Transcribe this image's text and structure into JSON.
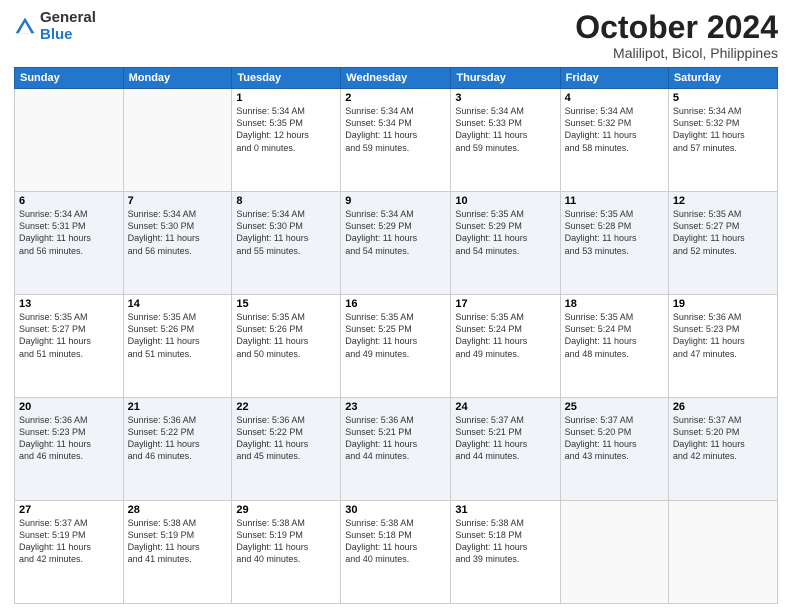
{
  "header": {
    "logo_general": "General",
    "logo_blue": "Blue",
    "month_title": "October 2024",
    "location": "Malilipot, Bicol, Philippines"
  },
  "weekdays": [
    "Sunday",
    "Monday",
    "Tuesday",
    "Wednesday",
    "Thursday",
    "Friday",
    "Saturday"
  ],
  "weeks": [
    [
      {
        "day": "",
        "info": ""
      },
      {
        "day": "",
        "info": ""
      },
      {
        "day": "1",
        "info": "Sunrise: 5:34 AM\nSunset: 5:35 PM\nDaylight: 12 hours\nand 0 minutes."
      },
      {
        "day": "2",
        "info": "Sunrise: 5:34 AM\nSunset: 5:34 PM\nDaylight: 11 hours\nand 59 minutes."
      },
      {
        "day": "3",
        "info": "Sunrise: 5:34 AM\nSunset: 5:33 PM\nDaylight: 11 hours\nand 59 minutes."
      },
      {
        "day": "4",
        "info": "Sunrise: 5:34 AM\nSunset: 5:32 PM\nDaylight: 11 hours\nand 58 minutes."
      },
      {
        "day": "5",
        "info": "Sunrise: 5:34 AM\nSunset: 5:32 PM\nDaylight: 11 hours\nand 57 minutes."
      }
    ],
    [
      {
        "day": "6",
        "info": "Sunrise: 5:34 AM\nSunset: 5:31 PM\nDaylight: 11 hours\nand 56 minutes."
      },
      {
        "day": "7",
        "info": "Sunrise: 5:34 AM\nSunset: 5:30 PM\nDaylight: 11 hours\nand 56 minutes."
      },
      {
        "day": "8",
        "info": "Sunrise: 5:34 AM\nSunset: 5:30 PM\nDaylight: 11 hours\nand 55 minutes."
      },
      {
        "day": "9",
        "info": "Sunrise: 5:34 AM\nSunset: 5:29 PM\nDaylight: 11 hours\nand 54 minutes."
      },
      {
        "day": "10",
        "info": "Sunrise: 5:35 AM\nSunset: 5:29 PM\nDaylight: 11 hours\nand 54 minutes."
      },
      {
        "day": "11",
        "info": "Sunrise: 5:35 AM\nSunset: 5:28 PM\nDaylight: 11 hours\nand 53 minutes."
      },
      {
        "day": "12",
        "info": "Sunrise: 5:35 AM\nSunset: 5:27 PM\nDaylight: 11 hours\nand 52 minutes."
      }
    ],
    [
      {
        "day": "13",
        "info": "Sunrise: 5:35 AM\nSunset: 5:27 PM\nDaylight: 11 hours\nand 51 minutes."
      },
      {
        "day": "14",
        "info": "Sunrise: 5:35 AM\nSunset: 5:26 PM\nDaylight: 11 hours\nand 51 minutes."
      },
      {
        "day": "15",
        "info": "Sunrise: 5:35 AM\nSunset: 5:26 PM\nDaylight: 11 hours\nand 50 minutes."
      },
      {
        "day": "16",
        "info": "Sunrise: 5:35 AM\nSunset: 5:25 PM\nDaylight: 11 hours\nand 49 minutes."
      },
      {
        "day": "17",
        "info": "Sunrise: 5:35 AM\nSunset: 5:24 PM\nDaylight: 11 hours\nand 49 minutes."
      },
      {
        "day": "18",
        "info": "Sunrise: 5:35 AM\nSunset: 5:24 PM\nDaylight: 11 hours\nand 48 minutes."
      },
      {
        "day": "19",
        "info": "Sunrise: 5:36 AM\nSunset: 5:23 PM\nDaylight: 11 hours\nand 47 minutes."
      }
    ],
    [
      {
        "day": "20",
        "info": "Sunrise: 5:36 AM\nSunset: 5:23 PM\nDaylight: 11 hours\nand 46 minutes."
      },
      {
        "day": "21",
        "info": "Sunrise: 5:36 AM\nSunset: 5:22 PM\nDaylight: 11 hours\nand 46 minutes."
      },
      {
        "day": "22",
        "info": "Sunrise: 5:36 AM\nSunset: 5:22 PM\nDaylight: 11 hours\nand 45 minutes."
      },
      {
        "day": "23",
        "info": "Sunrise: 5:36 AM\nSunset: 5:21 PM\nDaylight: 11 hours\nand 44 minutes."
      },
      {
        "day": "24",
        "info": "Sunrise: 5:37 AM\nSunset: 5:21 PM\nDaylight: 11 hours\nand 44 minutes."
      },
      {
        "day": "25",
        "info": "Sunrise: 5:37 AM\nSunset: 5:20 PM\nDaylight: 11 hours\nand 43 minutes."
      },
      {
        "day": "26",
        "info": "Sunrise: 5:37 AM\nSunset: 5:20 PM\nDaylight: 11 hours\nand 42 minutes."
      }
    ],
    [
      {
        "day": "27",
        "info": "Sunrise: 5:37 AM\nSunset: 5:19 PM\nDaylight: 11 hours\nand 42 minutes."
      },
      {
        "day": "28",
        "info": "Sunrise: 5:38 AM\nSunset: 5:19 PM\nDaylight: 11 hours\nand 41 minutes."
      },
      {
        "day": "29",
        "info": "Sunrise: 5:38 AM\nSunset: 5:19 PM\nDaylight: 11 hours\nand 40 minutes."
      },
      {
        "day": "30",
        "info": "Sunrise: 5:38 AM\nSunset: 5:18 PM\nDaylight: 11 hours\nand 40 minutes."
      },
      {
        "day": "31",
        "info": "Sunrise: 5:38 AM\nSunset: 5:18 PM\nDaylight: 11 hours\nand 39 minutes."
      },
      {
        "day": "",
        "info": ""
      },
      {
        "day": "",
        "info": ""
      }
    ]
  ]
}
